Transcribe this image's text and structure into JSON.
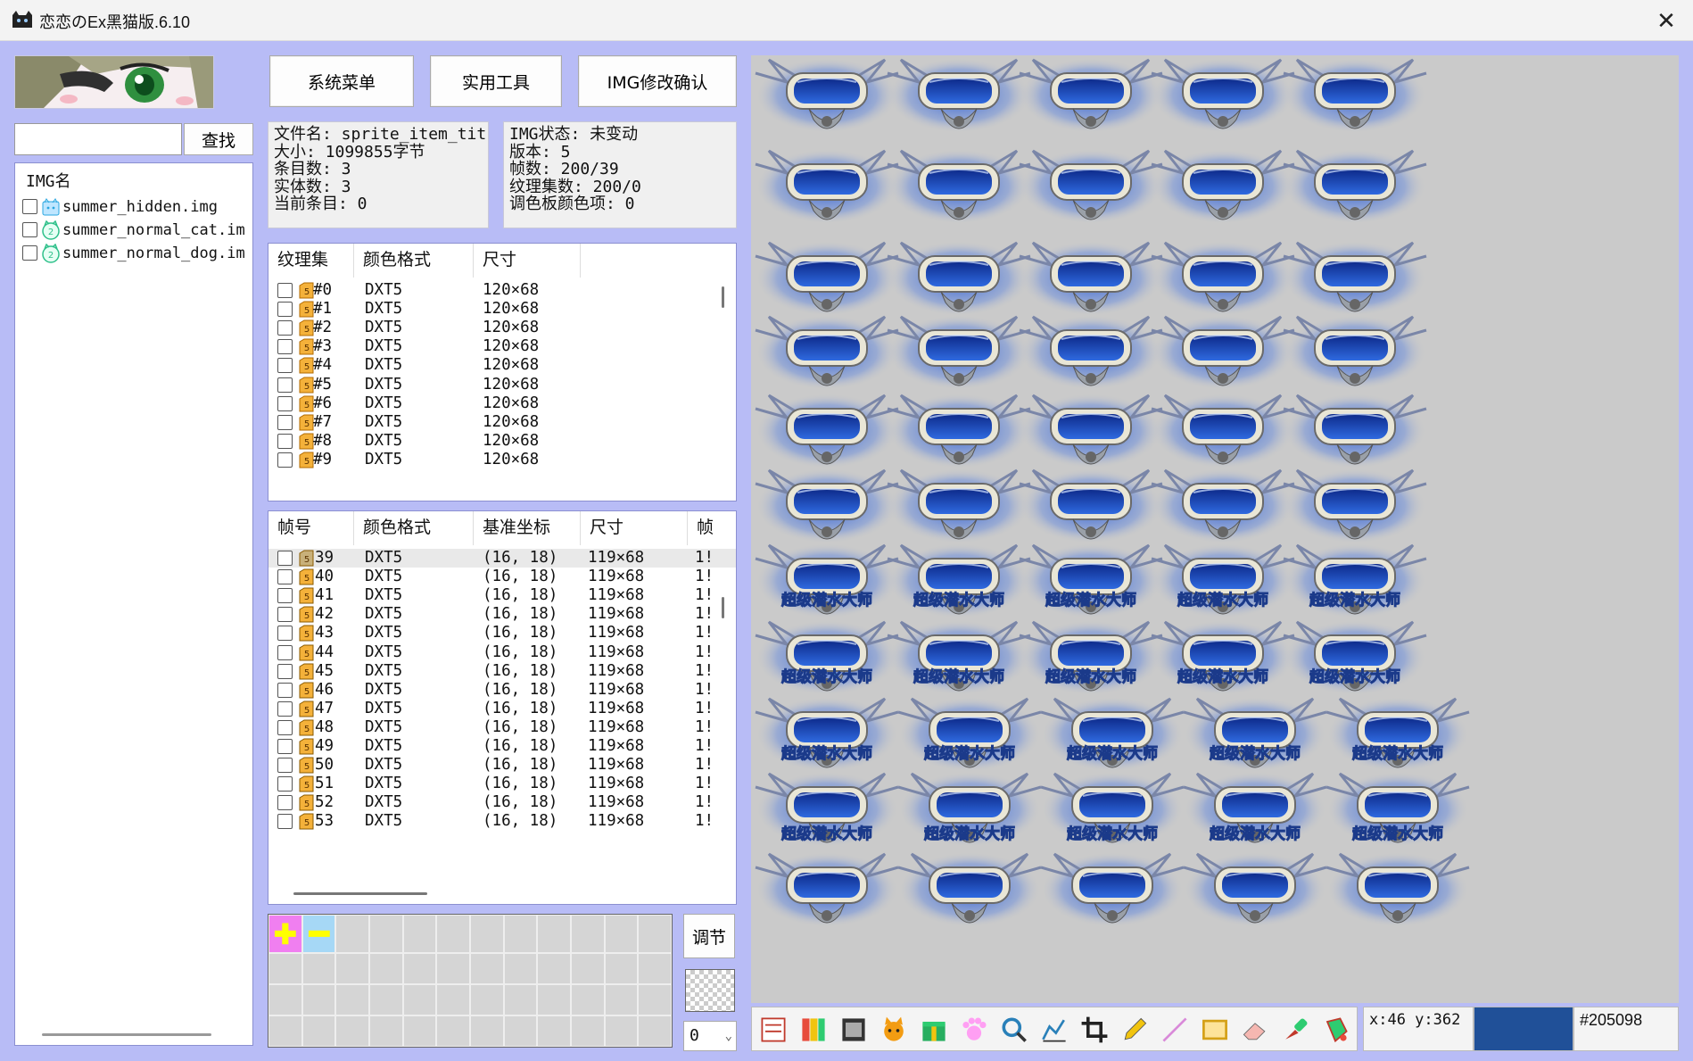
{
  "window": {
    "title": "恋恋のEx黑猫版.6.10"
  },
  "search": {
    "value": "",
    "button_label": "查找"
  },
  "img_list": {
    "header": "IMG名",
    "items": [
      {
        "name": "summer_hidden.img",
        "icon": "cat-folder-icon"
      },
      {
        "name": "summer_normal_cat.im",
        "icon": "cat-version-2-icon"
      },
      {
        "name": "summer_normal_dog.im",
        "icon": "cat-version-2-icon"
      }
    ]
  },
  "toolbar_buttons": {
    "system_menu": "系统菜单",
    "tools": "实用工具",
    "img_confirm": "IMG修改确认"
  },
  "file_info": [
    "文件名: sprite_item_tit",
    "大小: 1099855字节",
    "条目数: 3",
    "实体数: 3",
    "当前条目: 0"
  ],
  "img_info": [
    "IMG状态: 未变动",
    "版本: 5",
    "帧数: 200/39",
    "纹理集数: 200/0",
    "调色板颜色项: 0"
  ],
  "texture_table": {
    "columns": [
      "纹理集",
      "颜色格式",
      "尺寸"
    ],
    "rows": [
      {
        "id": "#0",
        "format": "DXT5",
        "size": "120×68"
      },
      {
        "id": "#1",
        "format": "DXT5",
        "size": "120×68"
      },
      {
        "id": "#2",
        "format": "DXT5",
        "size": "120×68"
      },
      {
        "id": "#3",
        "format": "DXT5",
        "size": "120×68"
      },
      {
        "id": "#4",
        "format": "DXT5",
        "size": "120×68"
      },
      {
        "id": "#5",
        "format": "DXT5",
        "size": "120×68"
      },
      {
        "id": "#6",
        "format": "DXT5",
        "size": "120×68"
      },
      {
        "id": "#7",
        "format": "DXT5",
        "size": "120×68"
      },
      {
        "id": "#8",
        "format": "DXT5",
        "size": "120×68"
      },
      {
        "id": "#9",
        "format": "DXT5",
        "size": "120×68"
      }
    ]
  },
  "frame_table": {
    "columns": [
      "帧号",
      "颜色格式",
      "基准坐标",
      "尺寸",
      "帧"
    ],
    "rows": [
      {
        "id": "39",
        "format": "DXT5",
        "base": "(16, 18)",
        "size": "119×68",
        "extra": "1!"
      },
      {
        "id": "40",
        "format": "DXT5",
        "base": "(16, 18)",
        "size": "119×68",
        "extra": "1!"
      },
      {
        "id": "41",
        "format": "DXT5",
        "base": "(16, 18)",
        "size": "119×68",
        "extra": "1!"
      },
      {
        "id": "42",
        "format": "DXT5",
        "base": "(16, 18)",
        "size": "119×68",
        "extra": "1!"
      },
      {
        "id": "43",
        "format": "DXT5",
        "base": "(16, 18)",
        "size": "119×68",
        "extra": "1!"
      },
      {
        "id": "44",
        "format": "DXT5",
        "base": "(16, 18)",
        "size": "119×68",
        "extra": "1!"
      },
      {
        "id": "45",
        "format": "DXT5",
        "base": "(16, 18)",
        "size": "119×68",
        "extra": "1!"
      },
      {
        "id": "46",
        "format": "DXT5",
        "base": "(16, 18)",
        "size": "119×68",
        "extra": "1!"
      },
      {
        "id": "47",
        "format": "DXT5",
        "base": "(16, 18)",
        "size": "119×68",
        "extra": "1!"
      },
      {
        "id": "48",
        "format": "DXT5",
        "base": "(16, 18)",
        "size": "119×68",
        "extra": "1!"
      },
      {
        "id": "49",
        "format": "DXT5",
        "base": "(16, 18)",
        "size": "119×68",
        "extra": "1!"
      },
      {
        "id": "50",
        "format": "DXT5",
        "base": "(16, 18)",
        "size": "119×68",
        "extra": "1!"
      },
      {
        "id": "51",
        "format": "DXT5",
        "base": "(16, 18)",
        "size": "119×68",
        "extra": "1!"
      },
      {
        "id": "52",
        "format": "DXT5",
        "base": "(16, 18)",
        "size": "119×68",
        "extra": "1!"
      },
      {
        "id": "53",
        "format": "DXT5",
        "base": "(16, 18)",
        "size": "119×68",
        "extra": "1!"
      }
    ]
  },
  "palette": {
    "adjust_label": "调节",
    "index_value": "0"
  },
  "canvas": {
    "sprite_caption": "超级潜水大师"
  },
  "tools": [
    {
      "name": "layer-list-icon"
    },
    {
      "name": "color-columns-icon"
    },
    {
      "name": "film-strip-icon"
    },
    {
      "name": "cat-face-icon"
    },
    {
      "name": "gift-box-icon"
    },
    {
      "name": "paw-icon"
    },
    {
      "name": "magnifier-icon"
    },
    {
      "name": "chart-pen-icon"
    },
    {
      "name": "crop-icon"
    },
    {
      "name": "pencil-icon"
    },
    {
      "name": "line-icon"
    },
    {
      "name": "rectangle-icon"
    },
    {
      "name": "eraser-icon"
    },
    {
      "name": "eyedropper-icon"
    },
    {
      "name": "paint-bucket-icon"
    }
  ],
  "status": {
    "coords": "x:46 y:362",
    "hex": "#205098",
    "swatch_color": "#205098"
  },
  "colors": {
    "background": "#b8bcf6",
    "canvas_bg": "#cacaca",
    "mask_blue": "#1e40a8"
  }
}
